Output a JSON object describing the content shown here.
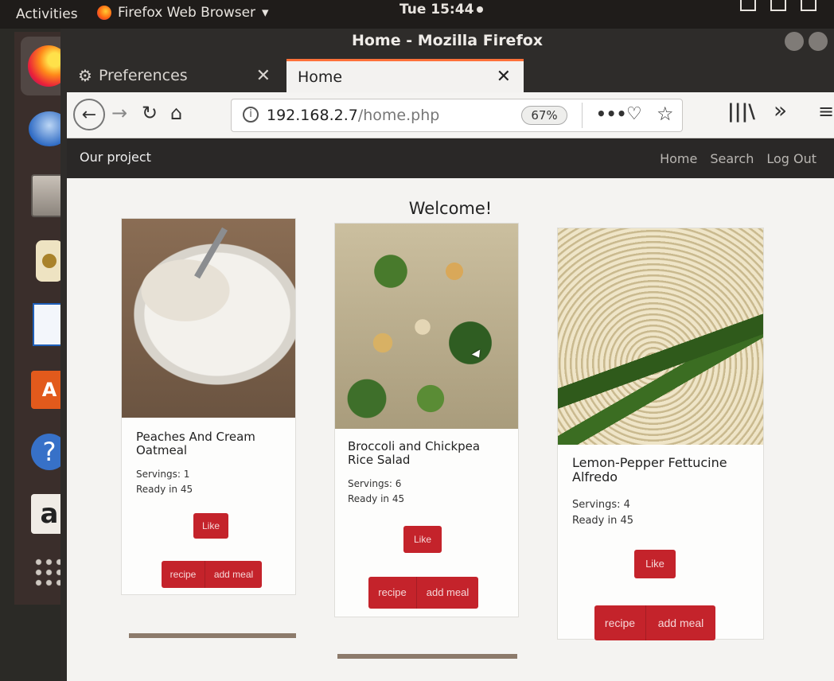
{
  "topbar": {
    "activities": "Activities",
    "app_menu": "Firefox Web Browser",
    "app_menu_arrow": "▾",
    "clock": "Tue 15:44"
  },
  "dock": {
    "items": [
      "firefox-icon",
      "thunderbird-icon",
      "files-icon",
      "rhythmbox-icon",
      "libreoffice-writer-icon",
      "software-store-icon",
      "help-icon",
      "amazon-icon",
      "show-apps-icon"
    ],
    "store_glyph": "A",
    "help_glyph": "?",
    "amazon_glyph": "a"
  },
  "window": {
    "title": "Home - Mozilla Firefox",
    "tabs": [
      {
        "label": "Preferences",
        "close": "✕",
        "icon": "gear-icon"
      },
      {
        "label": "Home",
        "close": "✕"
      }
    ],
    "new_tab": "+",
    "url_host": "192.168.2.7",
    "url_path": "/home.php",
    "zoom": "67%",
    "page_actions": "•••"
  },
  "site": {
    "brand": "Our project",
    "nav": [
      "Home",
      "Search",
      "Log Out"
    ],
    "welcome": "Welcome!",
    "recipes": [
      {
        "title": "Peaches And Cream Oatmeal",
        "servings": "Servings: 1",
        "ready": "Ready in 45",
        "like": "Like",
        "recipe": "recipe",
        "add_meal": "add meal"
      },
      {
        "title": "Broccoli and Chickpea Rice Salad",
        "servings": "Servings: 6",
        "ready": "Ready in 45",
        "like": "Like",
        "recipe": "recipe",
        "add_meal": "add meal"
      },
      {
        "title": "Lemon-Pepper Fettucine Alfredo",
        "servings": "Servings: 4",
        "ready": "Ready in 45",
        "like": "Like",
        "recipe": "recipe",
        "add_meal": "add meal"
      }
    ]
  },
  "colors": {
    "accent_button": "#c4232b",
    "tab_highlight": "#ff7139",
    "navbar_dark": "#2a2827"
  }
}
